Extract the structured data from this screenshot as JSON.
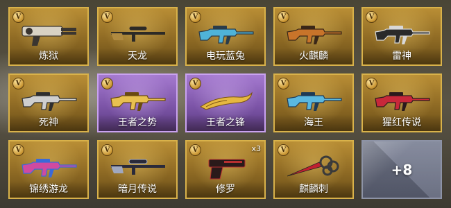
{
  "badge_letter": "V",
  "cards": [
    {
      "name": "炼狱",
      "theme": "gold",
      "weapon_icon": "gatling-gun-icon",
      "colors": [
        "#d8d2c4",
        "#3a3530"
      ]
    },
    {
      "name": "天龙",
      "theme": "gold",
      "weapon_icon": "sniper-rifle-icon",
      "colors": [
        "#2c2a26",
        "#b08a40"
      ]
    },
    {
      "name": "电玩蓝兔",
      "theme": "gold",
      "weapon_icon": "assault-rifle-icon",
      "colors": [
        "#4fb3d8",
        "#2a3c4a"
      ]
    },
    {
      "name": "火麒麟",
      "theme": "gold",
      "weapon_icon": "ak-rifle-icon",
      "colors": [
        "#c8742a",
        "#3a2718"
      ]
    },
    {
      "name": "雷神",
      "theme": "gold",
      "weapon_icon": "carbine-rifle-icon",
      "colors": [
        "#2a2a2a",
        "#d8d8d8"
      ]
    },
    {
      "name": "死神",
      "theme": "gold",
      "weapon_icon": "m4-rifle-icon",
      "colors": [
        "#cfcfcf",
        "#2e2e2e"
      ]
    },
    {
      "name": "王者之势",
      "theme": "purple",
      "weapon_icon": "golden-rifle-icon",
      "colors": [
        "#e8c050",
        "#6a4a10"
      ]
    },
    {
      "name": "王者之锋",
      "theme": "purple",
      "weapon_icon": "golden-blade-icon",
      "colors": [
        "#e6b840",
        "#7a5214"
      ]
    },
    {
      "name": "海王",
      "theme": "gold",
      "weapon_icon": "blue-rifle-icon",
      "colors": [
        "#5ab8e0",
        "#1e3a55"
      ]
    },
    {
      "name": "猩红传说",
      "theme": "gold",
      "weapon_icon": "crimson-rifle-icon",
      "colors": [
        "#c8283a",
        "#2a1a1c"
      ]
    },
    {
      "name": "锦绣游龙",
      "theme": "gold",
      "weapon_icon": "dragon-ak-icon",
      "colors": [
        "#d04aa0",
        "#3a6ad8"
      ]
    },
    {
      "name": "暗月传说",
      "theme": "gold",
      "weapon_icon": "dark-sniper-icon",
      "colors": [
        "#2a2a3a",
        "#a0a8c0"
      ]
    },
    {
      "name": "修罗",
      "theme": "gold",
      "weapon_icon": "pistol-icon",
      "colors": [
        "#2a1a1a",
        "#b83030"
      ],
      "count": "x3"
    },
    {
      "name": "麒麟刺",
      "theme": "gold",
      "weapon_icon": "knuckle-blade-icon",
      "colors": [
        "#3a3a3a",
        "#c02030"
      ]
    }
  ],
  "more": {
    "label": "+8"
  }
}
